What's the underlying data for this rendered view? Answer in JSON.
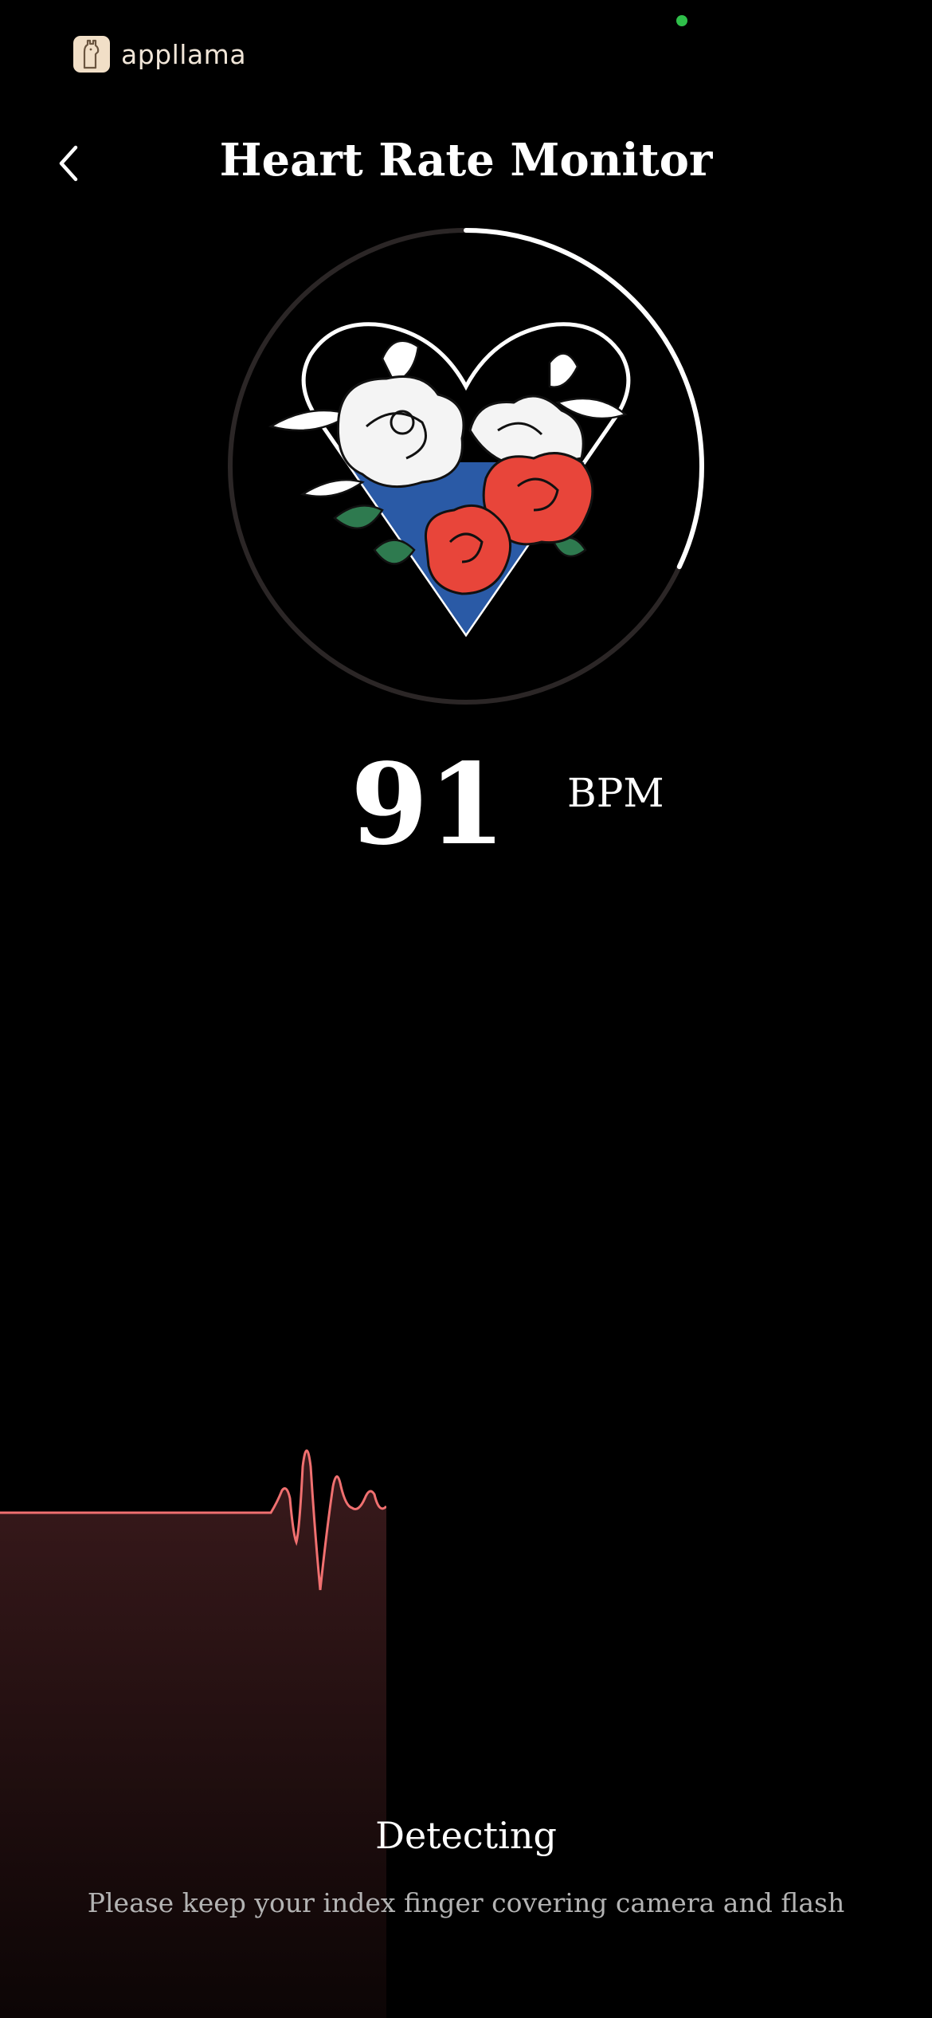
{
  "brand": {
    "name": "appllama",
    "icon": "llama-logo-icon"
  },
  "header": {
    "title": "Heart Rate Monitor",
    "back_icon": "chevron-left-icon"
  },
  "measurement": {
    "value": "91",
    "unit": "BPM",
    "progress": 0.32
  },
  "status": {
    "label": "Detecting",
    "instruction": "Please keep your index finger covering camera and flash"
  },
  "colors": {
    "background": "#000000",
    "waveform": "#f07070",
    "ring_track": "#2b2626",
    "ring_progress": "#ffffff",
    "indicator_dot": "#2fbf4a",
    "heart_red": "#e8453a",
    "heart_blue": "#2a5aa6"
  }
}
